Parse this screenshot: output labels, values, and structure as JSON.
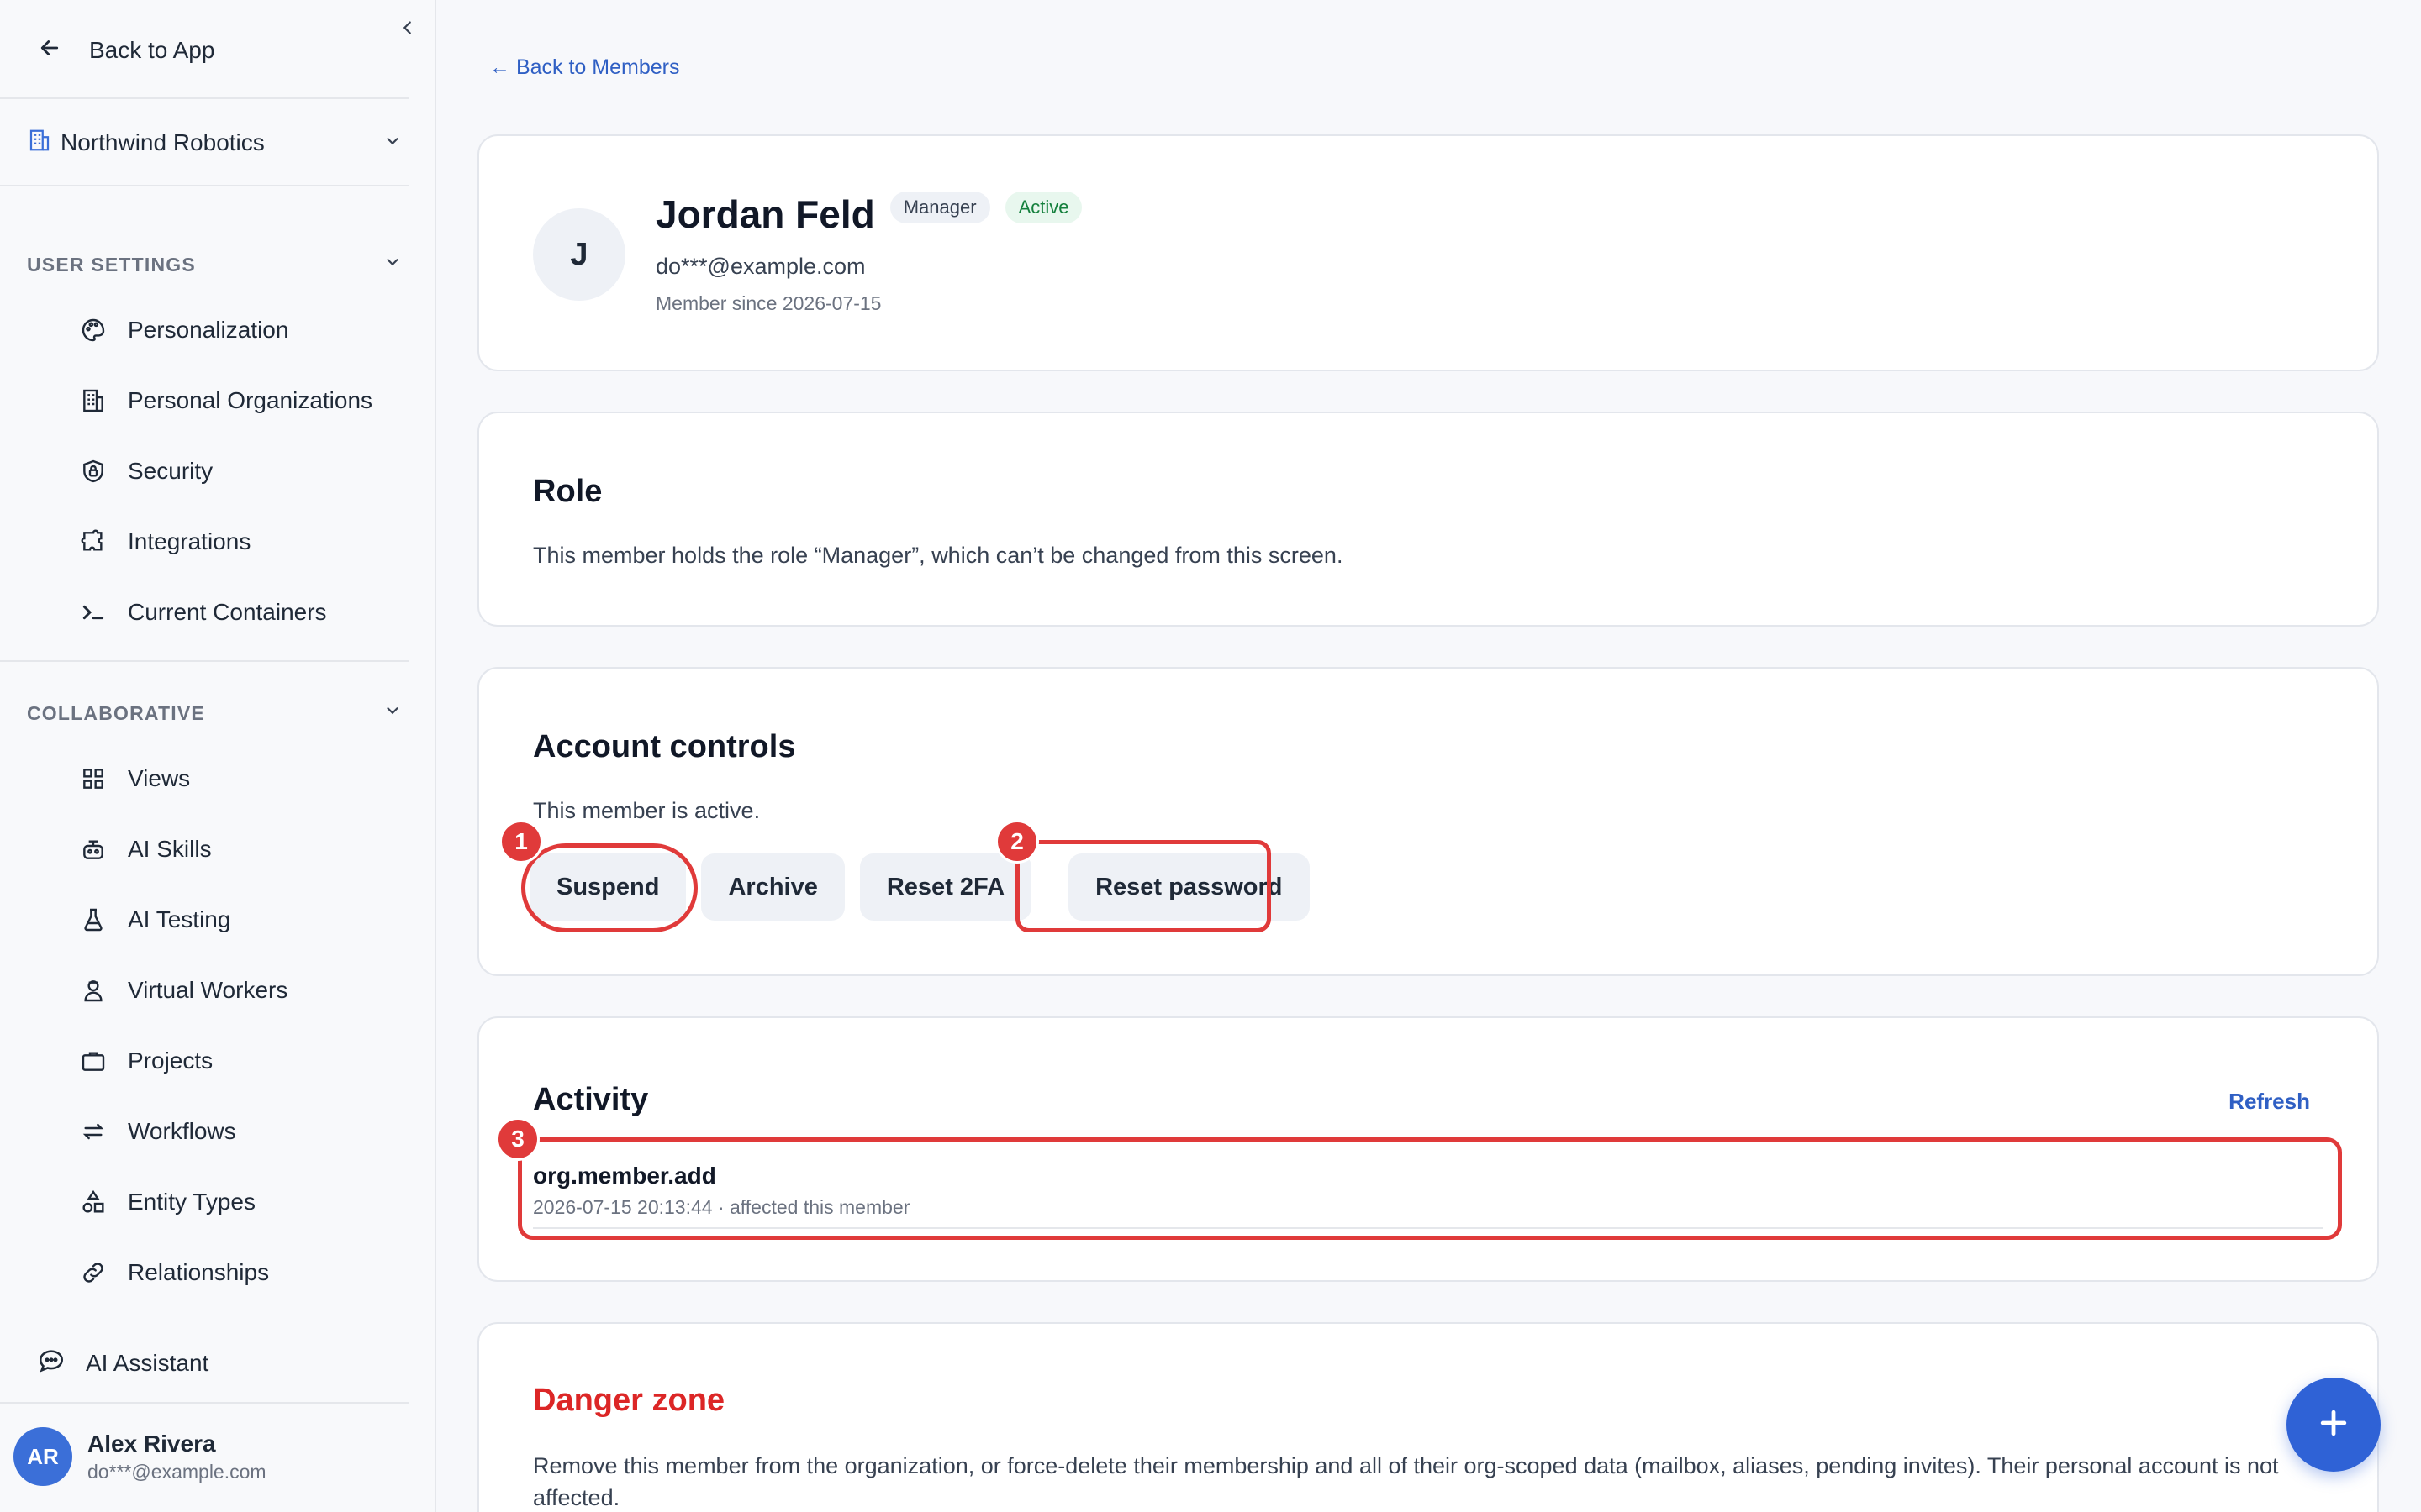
{
  "sidebar": {
    "back_label": "Back to App",
    "organization": "Northwind Robotics",
    "sections": [
      {
        "title": "USER SETTINGS",
        "items": [
          {
            "label": "Personalization",
            "icon": "palette-icon"
          },
          {
            "label": "Personal Organizations",
            "icon": "building-icon"
          },
          {
            "label": "Security",
            "icon": "shield-icon"
          },
          {
            "label": "Integrations",
            "icon": "puzzle-icon"
          },
          {
            "label": "Current Containers",
            "icon": "terminal-icon"
          }
        ]
      },
      {
        "title": "COLLABORATIVE",
        "items": [
          {
            "label": "Views",
            "icon": "grid-icon"
          },
          {
            "label": "AI Skills",
            "icon": "robot-icon"
          },
          {
            "label": "AI Testing",
            "icon": "flask-icon"
          },
          {
            "label": "Virtual Workers",
            "icon": "worker-icon"
          },
          {
            "label": "Projects",
            "icon": "briefcase-icon"
          },
          {
            "label": "Workflows",
            "icon": "arrows-icon"
          },
          {
            "label": "Entity Types",
            "icon": "shapes-icon"
          },
          {
            "label": "Relationships",
            "icon": "link-icon"
          }
        ]
      }
    ],
    "assistant_label": "AI Assistant",
    "user": {
      "initials": "AR",
      "name": "Alex Rivera",
      "email": "do***@example.com"
    }
  },
  "main": {
    "back_link": "← Back to Members",
    "profile": {
      "initial": "J",
      "name": "Jordan Feld",
      "role_badge": "Manager",
      "status_badge": "Active",
      "email": "do***@example.com",
      "member_since": "Member since 2026-07-15"
    },
    "role": {
      "title": "Role",
      "description": "This member holds the role “Manager”, which can’t be changed from this screen."
    },
    "account_controls": {
      "title": "Account controls",
      "status_text": "This member is active.",
      "buttons": {
        "suspend": "Suspend",
        "archive": "Archive",
        "reset_2fa": "Reset 2FA",
        "reset_password": "Reset password"
      }
    },
    "activity": {
      "title": "Activity",
      "refresh_label": "Refresh",
      "items": [
        {
          "event": "org.member.add",
          "meta": "2026-07-15 20:13:44 · affected this member"
        }
      ]
    },
    "danger_zone": {
      "title": "Danger zone",
      "description": "Remove this member from the organization, or force-delete their membership and all of their org-scoped data (mailbox, aliases, pending invites). Their personal account is not affected."
    }
  },
  "annotations": {
    "marker_1": "1",
    "marker_2": "2",
    "marker_3": "3"
  },
  "colors": {
    "accent": "#2f62d6",
    "danger": "#dc2626",
    "annotation": "#e03a3a",
    "active": "#15803d"
  }
}
